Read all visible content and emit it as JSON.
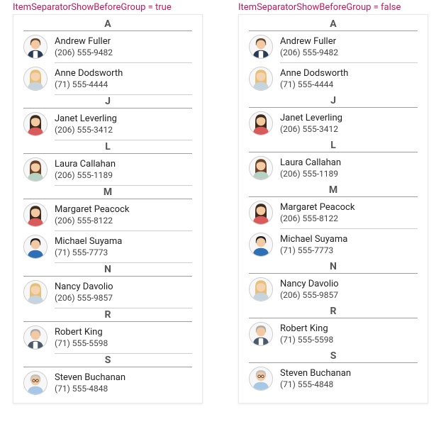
{
  "captions": {
    "left": "ItemSeparatorShowBeforeGroup = true",
    "right": "ItemSeparatorShowBeforeGroup = false"
  },
  "groups": [
    {
      "letter": "A",
      "items": [
        {
          "name": "Andrew Fuller",
          "phone": "(206) 555-9482",
          "avatar": "man-suit"
        },
        {
          "name": "Anne Dodsworth",
          "phone": "(71) 555-4444",
          "avatar": "woman-blonde"
        }
      ]
    },
    {
      "letter": "J",
      "items": [
        {
          "name": "Janet Leverling",
          "phone": "(206) 555-3412",
          "avatar": "woman-dark"
        }
      ]
    },
    {
      "letter": "L",
      "items": [
        {
          "name": "Laura Callahan",
          "phone": "(206) 555-1189",
          "avatar": "woman-brown"
        }
      ]
    },
    {
      "letter": "M",
      "items": [
        {
          "name": "Margaret Peacock",
          "phone": "(206) 555-8122",
          "avatar": "woman-dark"
        },
        {
          "name": "Michael Suyama",
          "phone": "(71) 555-7773",
          "avatar": "man-blue"
        }
      ]
    },
    {
      "letter": "N",
      "items": [
        {
          "name": "Nancy Davolio",
          "phone": "(206) 555-9857",
          "avatar": "woman-blonde"
        }
      ]
    },
    {
      "letter": "R",
      "items": [
        {
          "name": "Robert King",
          "phone": "(71) 555-5598",
          "avatar": "man-gray"
        }
      ]
    },
    {
      "letter": "S",
      "items": [
        {
          "name": "Steven Buchanan",
          "phone": "(71) 555-4848",
          "avatar": "man-glasses"
        }
      ]
    }
  ],
  "panels": [
    {
      "separatorBeforeGroup": true
    },
    {
      "separatorBeforeGroup": false
    }
  ]
}
